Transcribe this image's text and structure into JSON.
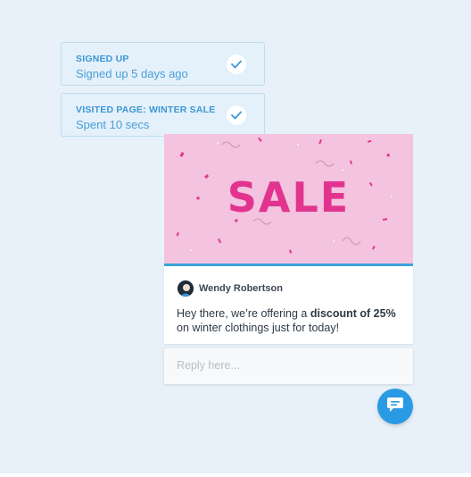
{
  "events": [
    {
      "title": "SIGNED UP",
      "subtitle": "Signed up 5 days ago"
    },
    {
      "title": "VISITED PAGE: WINTER SALE",
      "subtitle": "Spent 10 secs"
    }
  ],
  "banner": {
    "text": "SALE",
    "bg_color": "#f3c3df",
    "text_color": "#e2348e"
  },
  "message": {
    "author": "Wendy Robertson",
    "text_before": "Hey there, we’re offering a ",
    "text_bold": "discount of 25%",
    "text_after": " on winter clothings just for today!"
  },
  "reply": {
    "placeholder": "Reply here..."
  },
  "icons": {
    "check": "check-icon",
    "launcher": "chat-bubble-icon",
    "avatar": "avatar-image"
  },
  "colors": {
    "accent": "#3ba3dd",
    "launcher": "#2b9ae4",
    "event_text": "#3b97d5"
  }
}
